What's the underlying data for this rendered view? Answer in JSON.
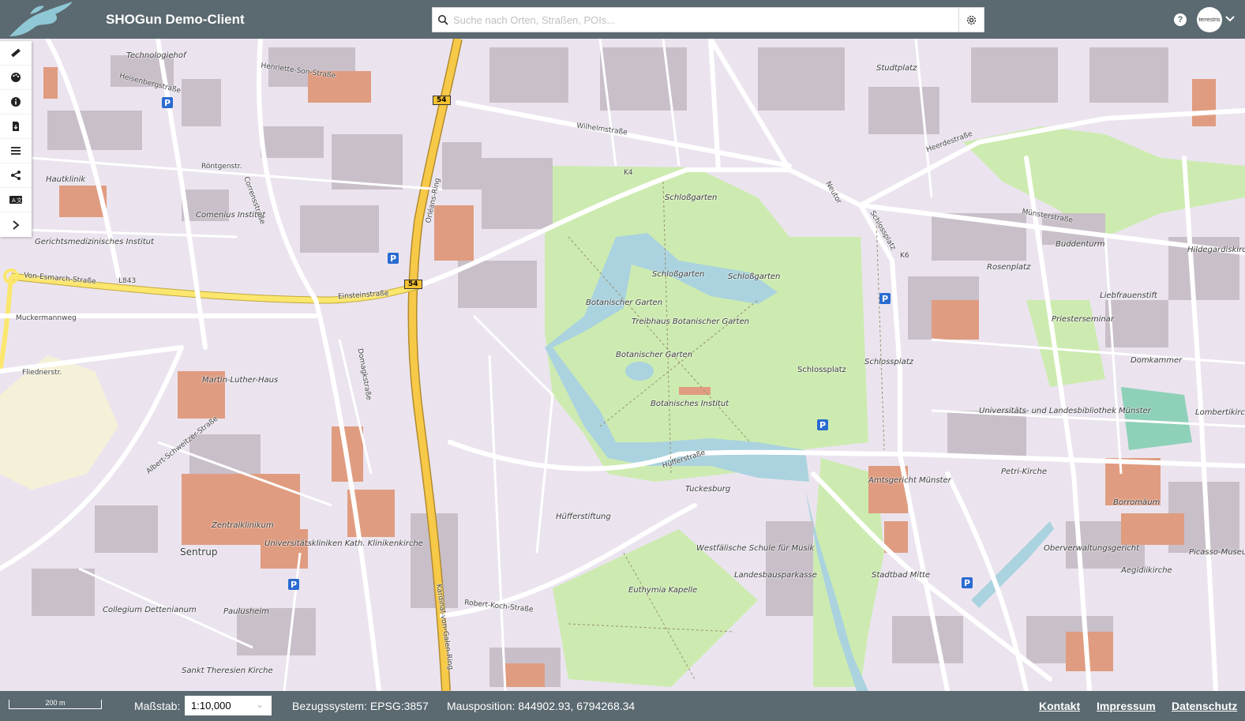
{
  "header": {
    "title": "SHOGun Demo-Client",
    "search_placeholder": "Suche nach Orten, Straßen, POIs...",
    "help_label": "?",
    "avatar_text": "terrestris"
  },
  "toolbar": {
    "items": [
      {
        "name": "measure-icon"
      },
      {
        "name": "palette-icon"
      },
      {
        "name": "info-icon"
      },
      {
        "name": "print-icon"
      },
      {
        "name": "layers-icon"
      },
      {
        "name": "share-icon"
      },
      {
        "name": "language-icon"
      },
      {
        "name": "expand-icon"
      }
    ]
  },
  "map": {
    "labels": [
      "Technologiehof",
      "Hautklinik",
      "Comenius Institut",
      "Gerichtsmedizinisches Institut",
      "Martin-Luther-Haus",
      "Zentralklinikum",
      "Universitätskliniken Kath. Klinikenkirche",
      "Sentrup",
      "Collegium Dettenianum",
      "Paulusheim",
      "Sankt Theresien Kirche",
      "Schloßgarten",
      "Schloßgarten",
      "Schloßgarten",
      "Botanischer Garten",
      "Treibhaus Botanischer Garten",
      "Botanischer Garten",
      "Botanisches Institut",
      "Schlossplatz",
      "Schlossplatz",
      "Hüfferstiftung",
      "Tuckesburg",
      "Westfälische Schule für Musik",
      "Landesbausparkasse",
      "Euthymia Kapelle",
      "Amtsgericht Münster",
      "Stadtbad Mitte",
      "Universitäts- und Landesbibliothek Münster",
      "Petri-Kirche",
      "Borromäum",
      "Oberverwaltungsgericht",
      "Aegidiikirche",
      "Picasso-Museum",
      "Domkammer",
      "Liebfrauenstift",
      "Priesterseminar",
      "Buddenturm",
      "Rosenplatz",
      "Studtplatz",
      "Hildegardiskirche",
      "Lombertikirche"
    ],
    "streets": [
      "Von-Esmarch-Straße",
      "Einsteinstraße",
      "Orléans-Ring",
      "Kardinal-von-Galen-Ring",
      "Albert-Schweitzer-Straße",
      "Hüfferstraße",
      "Robert-Koch-Straße",
      "Wilhelmstraße",
      "Neutor",
      "Schlossplatz",
      "Münsterstraße",
      "Heerdestraße",
      "Fliednerstr.",
      "Muckermannweg",
      "Domagkstraße",
      "Corrensstraße",
      "Röntgenstr.",
      "Heisenbergstraße",
      "Henriette-Son-Straße"
    ],
    "road_numbers": [
      "54",
      "54",
      "L843",
      "K4",
      "K6"
    ],
    "parking": [
      "P",
      "P",
      "P",
      "P",
      "P",
      "P"
    ]
  },
  "footer": {
    "scale_bar": "200 m",
    "scale_label": "Maßstab:",
    "scale_value": "1:10,000",
    "crs_text": "Bezugssystem: EPSG:3857",
    "mouse_position": "Mausposition: 844902.93, 6794268.34",
    "links": {
      "contact": "Kontakt",
      "imprint": "Impressum",
      "privacy": "Datenschutz"
    }
  },
  "colors": {
    "header_bg": "#5b6970",
    "map_bg": "#ebe4ef",
    "park": "#cdebb0",
    "building": "#c9bfc9",
    "highway": "#f7c948"
  }
}
